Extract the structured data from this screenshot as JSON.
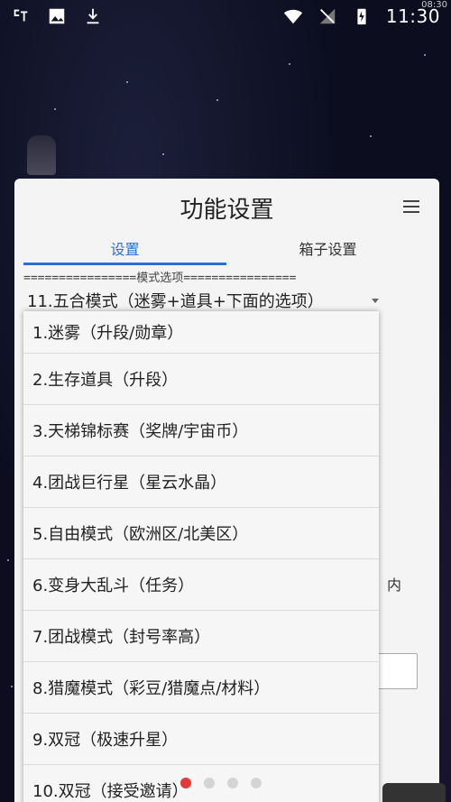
{
  "status_bar": {
    "left_icons": [
      "notification-app-icon",
      "image-icon",
      "download-icon"
    ],
    "right_icons": [
      "wifi-icon",
      "no-signal-icon",
      "battery-charging-icon"
    ],
    "time": "11:30",
    "corner_text": "08:30"
  },
  "panel": {
    "title": "功能设置",
    "tabs": [
      {
        "label": "设置",
        "active": true
      },
      {
        "label": "箱子设置",
        "active": false
      }
    ],
    "section_header": "================模式选项================",
    "mode_select": {
      "selected": "11.五合模式（迷雾+道具+下面的选项）"
    },
    "side_text": "内"
  },
  "dropdown": {
    "options": [
      "1.迷雾（升段/勋章）",
      "2.生存道具（升段）",
      "3.天梯锦标赛（奖牌/宇宙币）",
      "4.团战巨行星（星云水晶）",
      "5.自由模式（欧洲区/北美区）",
      "6.变身大乱斗（任务）",
      "7.团战模式（封号率高）",
      "8.猎魔模式（彩豆/猎魔点/材料）",
      "9.双冠（极速升星）",
      "10.双冠（接受邀请）"
    ]
  },
  "pager": {
    "count": 4,
    "active_index": 0
  },
  "colors": {
    "accent": "#2a6fd6",
    "pager_active": "#e53935",
    "panel_bg": "#f4f4f4"
  }
}
